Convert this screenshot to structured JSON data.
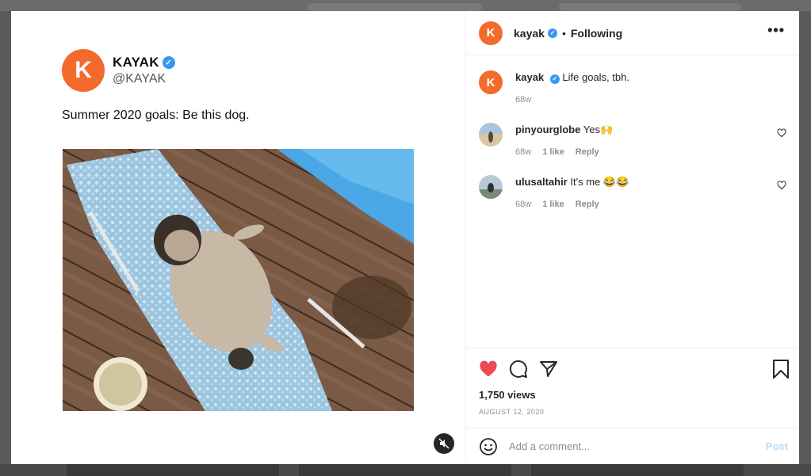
{
  "post": {
    "account_initial": "K",
    "tweet_name": "KAYAK",
    "tweet_handle": "@KAYAK",
    "tweet_text": "Summer 2020 goals: Be this dog."
  },
  "header": {
    "initial": "K",
    "username": "kayak",
    "separator": "•",
    "follow_status": "Following",
    "more": "•••"
  },
  "comments": [
    {
      "username": "kayak",
      "text": "Life goals, tbh.",
      "age": "68w",
      "likes": "",
      "reply": ""
    },
    {
      "username": "pinyourglobe",
      "text": "Yes🙌",
      "age": "68w",
      "likes": "1 like",
      "reply": "Reply"
    },
    {
      "username": "ulusaltahir",
      "text": "It's me 😂😂",
      "age": "68w",
      "likes": "1 like",
      "reply": "Reply"
    }
  ],
  "stats": {
    "views": "1,750 views",
    "date": "AUGUST 12, 2020"
  },
  "composer": {
    "placeholder": "Add a comment...",
    "post_label": "Post"
  },
  "colors": {
    "brand": "#f26b2c",
    "verified": "#3897f0",
    "like": "#ed4956",
    "post_disabled": "#b2dffc"
  }
}
